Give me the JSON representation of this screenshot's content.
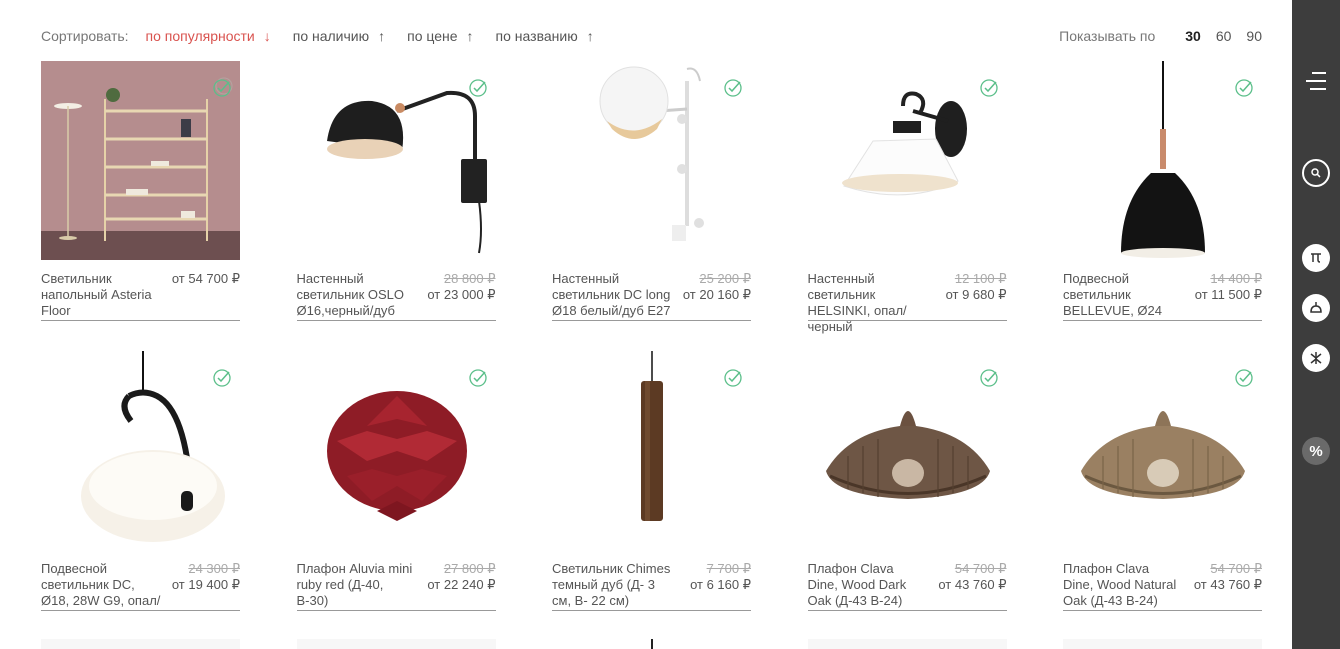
{
  "sort": {
    "label": "Сортировать:",
    "items": [
      {
        "label": "по популярности",
        "arrow": "↓",
        "active": true
      },
      {
        "label": "по наличию",
        "arrow": "↑",
        "active": false
      },
      {
        "label": "по цене",
        "arrow": "↑",
        "active": false
      },
      {
        "label": "по названию",
        "arrow": "↑",
        "active": false
      }
    ]
  },
  "per_page": {
    "label": "Показывать по",
    "options": [
      "30",
      "60",
      "90"
    ],
    "selected": "30"
  },
  "products": [
    {
      "name": "Светильник напольный Asteria Floor",
      "old_price": "",
      "price": "от 54 700 ₽",
      "image": "floor-lamp-shelf-photo"
    },
    {
      "name": "Настенный светильник OSLO Ø16,черный/дуб",
      "old_price": "28 800 ₽",
      "price": "от 23 000 ₽",
      "image": "black-wall-lamp"
    },
    {
      "name": "Настенный светильник DC long Ø18 белый/дуб E27",
      "old_price": "25 200 ₽",
      "price": "от 20 160 ₽",
      "image": "white-wall-lamp"
    },
    {
      "name": "Настенный светильник HELSINKI, опал/черный",
      "old_price": "12 100 ₽",
      "price": "от 9 680 ₽",
      "image": "opal-wall-lamp"
    },
    {
      "name": "Подвесной светильник BELLEVUE, Ø24",
      "old_price": "14 400 ₽",
      "price": "от 11 500 ₽",
      "image": "black-pendant"
    },
    {
      "name": "Подвесной светильник DC, Ø18, 28W G9, опал/",
      "old_price": "24 300 ₽",
      "price": "от 19 400 ₽",
      "image": "opal-pendant"
    },
    {
      "name": "Плафон Aluvia mini ruby red (Д-40, В-30)",
      "old_price": "27 800 ₽",
      "price": "от 22 240 ₽",
      "image": "ruby-cone-shade"
    },
    {
      "name": "Светильник Chimes темный дуб (Д- 3 см, В- 22 см)",
      "old_price": "7 700 ₽",
      "price": "от 6 160 ₽",
      "image": "oak-tube-pendant"
    },
    {
      "name": "Плафон Clava Dine, Wood Dark Oak (Д-43 В-24)",
      "old_price": "54 700 ₽",
      "price": "от 43 760 ₽",
      "image": "dark-oak-shade"
    },
    {
      "name": "Плафон Clava Dine, Wood Natural Oak (Д-43 В-24)",
      "old_price": "54 700 ₽",
      "price": "от 43 760 ₽",
      "image": "natural-oak-shade"
    }
  ],
  "colors": {
    "accent": "#d9534f",
    "check": "#5bbf8a",
    "sidebar": "#3d3d3d"
  },
  "sidebar": {
    "icons": [
      "menu-icon",
      "search-icon",
      "table-lamp-icon",
      "pendant-lamp-icon",
      "chandelier-icon",
      "percent-icon"
    ],
    "percent_symbol": "%"
  }
}
